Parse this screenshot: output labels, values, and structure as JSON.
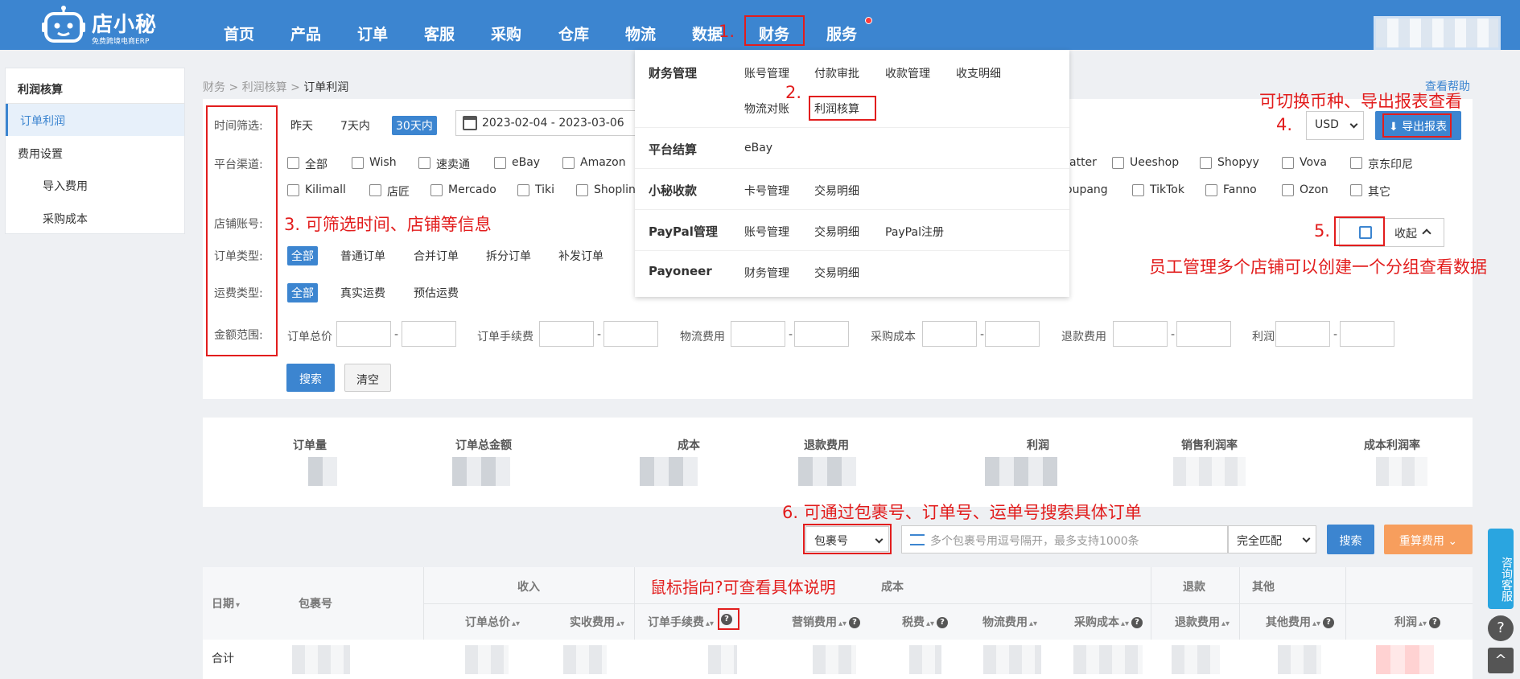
{
  "header": {
    "logo_title": "店小秘",
    "logo_sub": "免费跨境电商ERP",
    "nav": [
      "首页",
      "产品",
      "订单",
      "客服",
      "采购",
      "仓库",
      "物流",
      "数据",
      "财务",
      "服务"
    ]
  },
  "sidebar": {
    "title": "利润核算",
    "items": [
      "订单利润",
      "费用设置",
      "导入费用",
      "采购成本"
    ]
  },
  "breadcrumb": [
    "财务",
    "利润核算",
    "订单利润"
  ],
  "help": "查看帮助",
  "filters": {
    "time_label": "时间筛选:",
    "time_opts": [
      "昨天",
      "7天内",
      "30天内"
    ],
    "date_range": "2023-02-04 - 2023-03-06",
    "platform_label": "平台渠道:",
    "platforms_row1_left": [
      "全部",
      "Wish",
      "速卖通",
      "eBay",
      "Amazon"
    ],
    "platforms_row1_right": [
      "atter",
      "Ueeshop",
      "Shopyy",
      "Vova",
      "京东印尼"
    ],
    "platforms_row2_left": [
      "Kilimall",
      "店匠",
      "Mercado",
      "Tiki",
      "Shopline"
    ],
    "platforms_row2_right": [
      "oupang",
      "TikTok",
      "Fanno",
      "Ozon",
      "其它"
    ],
    "shop_label": "店铺账号:",
    "order_type_label": "订单类型:",
    "order_types": [
      "全部",
      "普通订单",
      "合并订单",
      "拆分订单",
      "补发订单"
    ],
    "freight_label": "运费类型:",
    "freight_types": [
      "全部",
      "真实运费",
      "预估运费"
    ],
    "amount_label": "金额范围:",
    "amount_fields": [
      "订单总价",
      "订单手续费",
      "物流费用",
      "采购成本",
      "退款费用",
      "利润"
    ],
    "dash": "-",
    "search": "搜索",
    "clear": "清空"
  },
  "toolbar": {
    "currency": "USD",
    "export": "导出报表",
    "collapse": "收起"
  },
  "stats": [
    "订单量",
    "订单总金额",
    "成本",
    "退款费用",
    "利润",
    "销售利润率",
    "成本利润率"
  ],
  "search_bar": {
    "type": "包裹号",
    "placeholder": "多个包裹号用逗号隔开，最多支持1000条",
    "match": "完全匹配",
    "search": "搜索",
    "recalc": "重算费用"
  },
  "table": {
    "col_date": "日期",
    "col_package": "包裹号",
    "groups": [
      "收入",
      "成本",
      "退款",
      "其他"
    ],
    "cols": [
      "订单总价",
      "实收费用",
      "订单手续费",
      "营销费用",
      "税费",
      "物流费用",
      "采购成本",
      "退款费用",
      "其他费用",
      "利润"
    ],
    "total": "合计"
  },
  "menu": {
    "rows": [
      {
        "cat": "财务管理",
        "links": [
          "账号管理",
          "付款审批",
          "收款管理",
          "收支明细",
          "物流对账",
          "利润核算"
        ]
      },
      {
        "cat": "平台结算",
        "links": [
          "eBay"
        ]
      },
      {
        "cat": "小秘收款",
        "links": [
          "卡号管理",
          "交易明细"
        ]
      },
      {
        "cat": "PayPal管理",
        "links": [
          "账号管理",
          "交易明细",
          "PayPal注册"
        ]
      },
      {
        "cat": "Payoneer",
        "links": [
          "财务管理",
          "交易明细"
        ]
      }
    ]
  },
  "annotations": {
    "a1": "1.",
    "a2": "2.",
    "a3": "3. 可筛选时间、店铺等信息",
    "a4_text": "可切换币种、导出报表查看",
    "a4": "4.",
    "a5": "5.",
    "a5_text": "员工管理多个店铺可以创建一个分组查看数据",
    "a6": "6. 可通过包裹号、订单号、运单号搜索具体订单",
    "a7": "鼠标指向?可查看具体说明"
  },
  "widget": {
    "consult": "咨询客服",
    "help_icon": "?",
    "top_icon": "^"
  }
}
